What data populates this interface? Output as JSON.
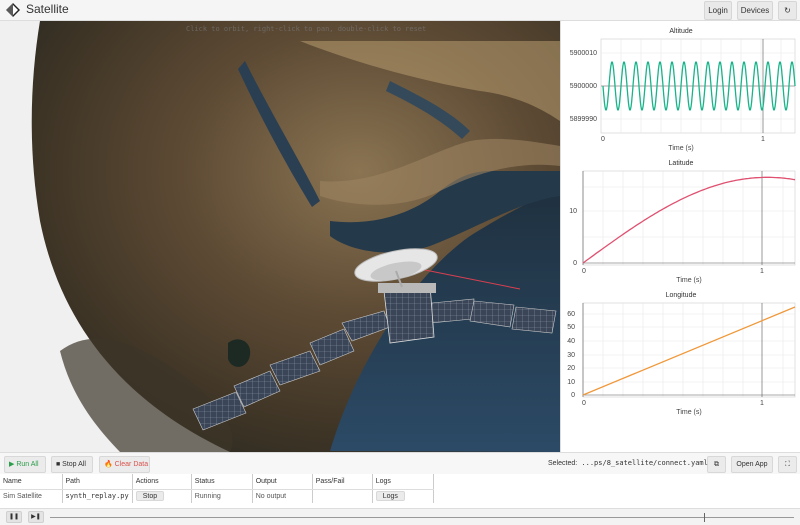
{
  "app": {
    "title": "Satellite"
  },
  "topbar": {
    "login_label": "Login",
    "devices_label": "Devices",
    "refresh_icon": "refresh-icon"
  },
  "viewport": {
    "hint": "Click to orbit, right-click to pan, double-click to reset"
  },
  "plots": {
    "altitude": {
      "title": "Altitude",
      "xlabel": "Time (s)",
      "yticks": [
        "5900010",
        "5900000",
        "5899990"
      ],
      "xticks": [
        "0",
        "1"
      ],
      "color": "#19b38a"
    },
    "latitude": {
      "title": "Latitude",
      "xlabel": "Time (s)",
      "yticks": [
        "10",
        "0"
      ],
      "xticks": [
        "0",
        "1"
      ],
      "color": "#e05070"
    },
    "longitude": {
      "title": "Longitude",
      "xlabel": "Time (s)",
      "yticks": [
        "60",
        "50",
        "40",
        "30",
        "20",
        "10",
        "0"
      ],
      "xticks": [
        "0",
        "1"
      ],
      "color": "#f0983a"
    }
  },
  "toolbar": {
    "run_all": "▶ Run All",
    "stop_all": "■ Stop All",
    "clear_data": "🔥 Clear Data",
    "selected_label": "Selected:",
    "selected_path": "...ps/8_satellite/connect.yaml",
    "open_app": "Open App"
  },
  "table": {
    "headers": [
      "Name",
      "Path",
      "Actions",
      "Status",
      "Output",
      "Pass/Fail",
      "Logs"
    ],
    "rows": [
      {
        "name": "Sim Satellite",
        "path": "synth_replay.py",
        "action": "Stop",
        "status": "Running",
        "output": "No output",
        "passfail": "",
        "logs": "Logs"
      }
    ]
  }
}
